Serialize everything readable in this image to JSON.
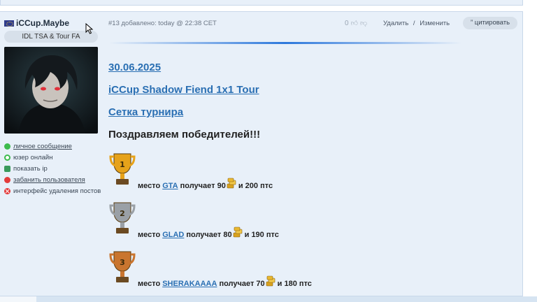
{
  "author": {
    "name": "iCCup.Maybe",
    "tag": "IDL TSA & Tour FA"
  },
  "user_links": [
    {
      "label": "личное сообщение",
      "icon": "message-icon",
      "underline": true
    },
    {
      "label": "юзер онлайн",
      "icon": "online-icon",
      "underline": false
    },
    {
      "label": "показать ip",
      "icon": "ip-icon",
      "underline": false
    },
    {
      "label": "забанить пользователя",
      "icon": "ban-icon",
      "underline": true
    },
    {
      "label": "интерфейс удаления постов",
      "icon": "delete-posts-icon",
      "underline": false
    }
  ],
  "post": {
    "meta": "#13 добавлено: today @ 22:38 CET",
    "rating": "0",
    "delete_label": "Удалить",
    "separator": "/",
    "edit_label": "Изменить",
    "quote_label": "” цитировать"
  },
  "content": {
    "date_link": "30.06.2025",
    "tour_link": "iCCup Shadow Fiend 1x1 Tour",
    "bracket_link": "Сетка турнира",
    "congrats": "Поздравляем победителей!!!",
    "places": [
      {
        "rank": "1",
        "word": "место",
        "team": "GTA",
        "gets": "получает",
        "coins": "90",
        "and": "и",
        "pts": "200",
        "pts_label": "птс",
        "color": "#e6a21a"
      },
      {
        "rank": "2",
        "word": "место",
        "team": "GLAD",
        "gets": "получает",
        "coins": "80",
        "and": "и",
        "pts": "190",
        "pts_label": "птс",
        "color": "#9aa0a6"
      },
      {
        "rank": "3",
        "word": "место",
        "team": "SHERAKAAAA",
        "gets": "получает",
        "coins": "70",
        "and": "и",
        "pts": "180",
        "pts_label": "птс",
        "color": "#c9752f"
      }
    ]
  },
  "colors": {
    "accent": "#2a6fb3",
    "panel": "#e8f0f9",
    "divider": "#2d78dc"
  }
}
